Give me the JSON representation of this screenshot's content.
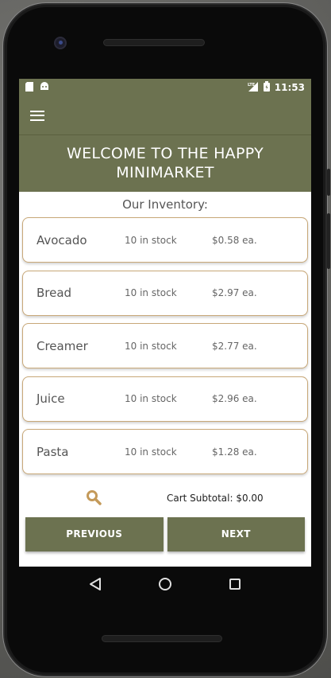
{
  "status": {
    "time": "11:53",
    "left_icons": [
      "sd-card-icon",
      "android-icon"
    ],
    "right_icons": [
      "lte-signal-icon",
      "battery-icon"
    ]
  },
  "appbar": {
    "menu_icon": "hamburger-menu-icon"
  },
  "banner": {
    "line1": "WELCOME TO THE HAPPY",
    "line2": "MINIMARKET"
  },
  "inventory": {
    "title": "Our Inventory:",
    "items": [
      {
        "name": "Avocado",
        "stock": "10 in stock",
        "price": "$0.58 ea."
      },
      {
        "name": "Bread",
        "stock": "10 in stock",
        "price": "$2.97 ea."
      },
      {
        "name": "Creamer",
        "stock": "10 in stock",
        "price": "$2.77 ea."
      },
      {
        "name": "Juice",
        "stock": "10 in stock",
        "price": "$2.96 ea."
      },
      {
        "name": "Pasta",
        "stock": "10 in stock",
        "price": "$1.28 ea."
      }
    ]
  },
  "cart": {
    "subtotal": "Cart Subtotal: $0.00",
    "search_icon": "search-icon"
  },
  "buttons": {
    "previous": "PREVIOUS",
    "next": "NEXT"
  },
  "colors": {
    "primary": "#6c7250",
    "card_border": "#c8a878",
    "search_icon": "#c49a5a"
  }
}
